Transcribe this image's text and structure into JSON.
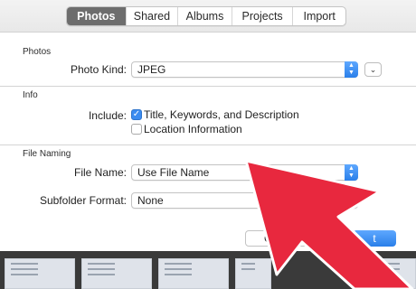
{
  "tabs": [
    {
      "label": "Photos",
      "active": true
    },
    {
      "label": "Shared",
      "active": false
    },
    {
      "label": "Albums",
      "active": false
    },
    {
      "label": "Projects",
      "active": false
    },
    {
      "label": "Import",
      "active": false
    }
  ],
  "sections": {
    "photos": {
      "title": "Photos",
      "photo_kind_label": "Photo Kind:",
      "photo_kind_value": "JPEG"
    },
    "info": {
      "title": "Info",
      "include_label": "Include:",
      "options": [
        {
          "label": "Title, Keywords, and Description",
          "checked": true
        },
        {
          "label": "Location Information",
          "checked": false
        }
      ]
    },
    "file_naming": {
      "title": "File Naming",
      "file_name_label": "File Name:",
      "file_name_value": "Use File Name",
      "subfolder_label": "Subfolder Format:",
      "subfolder_value": "None"
    }
  },
  "buttons": {
    "cancel": "Canc",
    "export": "t"
  },
  "colors": {
    "accent": "#2a7fe9",
    "arrow": "#e8283e",
    "arrow_outline": "#ffffff"
  },
  "icons": {
    "stepper": "up-down-chevron",
    "disclosure": "chevron-down",
    "checkmark": "check"
  }
}
